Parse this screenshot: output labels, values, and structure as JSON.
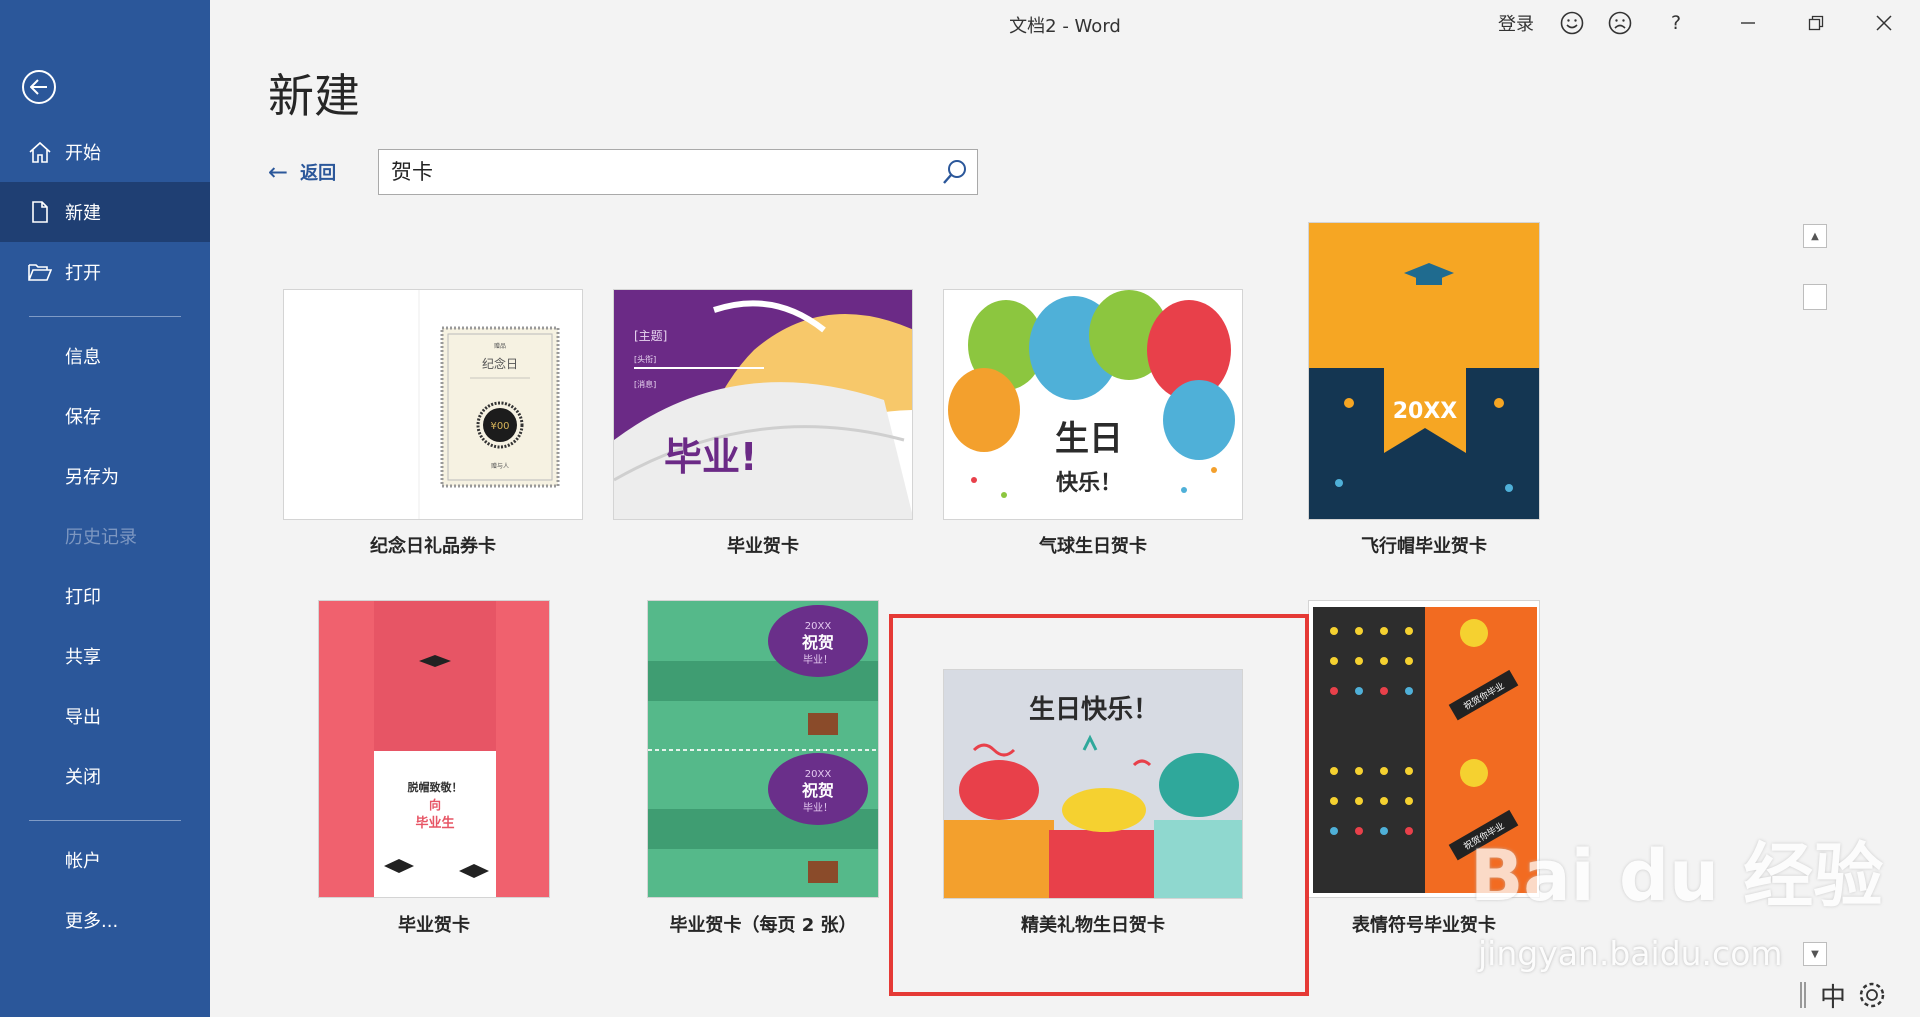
{
  "window": {
    "title": "文档2  -  Word",
    "signin": "登录",
    "help": "?"
  },
  "sidebar": {
    "items": [
      {
        "label": "开始"
      },
      {
        "label": "新建"
      },
      {
        "label": "打开"
      },
      {
        "label": "信息"
      },
      {
        "label": "保存"
      },
      {
        "label": "另存为"
      },
      {
        "label": "历史记录"
      },
      {
        "label": "打印"
      },
      {
        "label": "共享"
      },
      {
        "label": "导出"
      },
      {
        "label": "关闭"
      },
      {
        "label": "帐户"
      },
      {
        "label": "更多..."
      }
    ]
  },
  "main": {
    "heading": "新建",
    "back_label": "返回",
    "search_value": "贺卡",
    "templates": [
      {
        "label": "纪念日礼品券卡",
        "thumb_text": {
          "top": "赠品",
          "title": "纪念日",
          "amount": "¥00",
          "from": "赠与人"
        }
      },
      {
        "label": "毕业贺卡",
        "thumb_text": {
          "topic": "[主题]",
          "sub1": "[头衔]",
          "sub2": "[消息]",
          "big": "毕业!"
        }
      },
      {
        "label": "气球生日贺卡",
        "thumb_text": {
          "line1": "生日",
          "line2": "快乐！"
        }
      },
      {
        "label": "飞行帽毕业贺卡",
        "thumb_text": {
          "year": "20XX"
        }
      },
      {
        "label": "毕业贺卡",
        "thumb_text": {
          "line1": "脱帽致敬！",
          "line2": "向",
          "line3": "毕业生"
        }
      },
      {
        "label": "毕业贺卡（每页 2 张）",
        "thumb_text": {
          "year": "20XX",
          "main": "祝贺",
          "sub": "毕业！"
        }
      },
      {
        "label": "精美礼物生日贺卡",
        "thumb_text": {
          "title": "生日快乐！"
        }
      },
      {
        "label": "表情符号毕业贺卡",
        "thumb_text": {
          "text": "祝贺你毕业"
        }
      }
    ]
  },
  "status": {
    "ime": "中"
  },
  "watermark": {
    "brand": "Bai du 经验",
    "url": "jingyan.baidu.com"
  },
  "colors": {
    "sidebar": "#2b579a",
    "sidebar_active": "#1f3f73",
    "highlight": "#e53935"
  }
}
